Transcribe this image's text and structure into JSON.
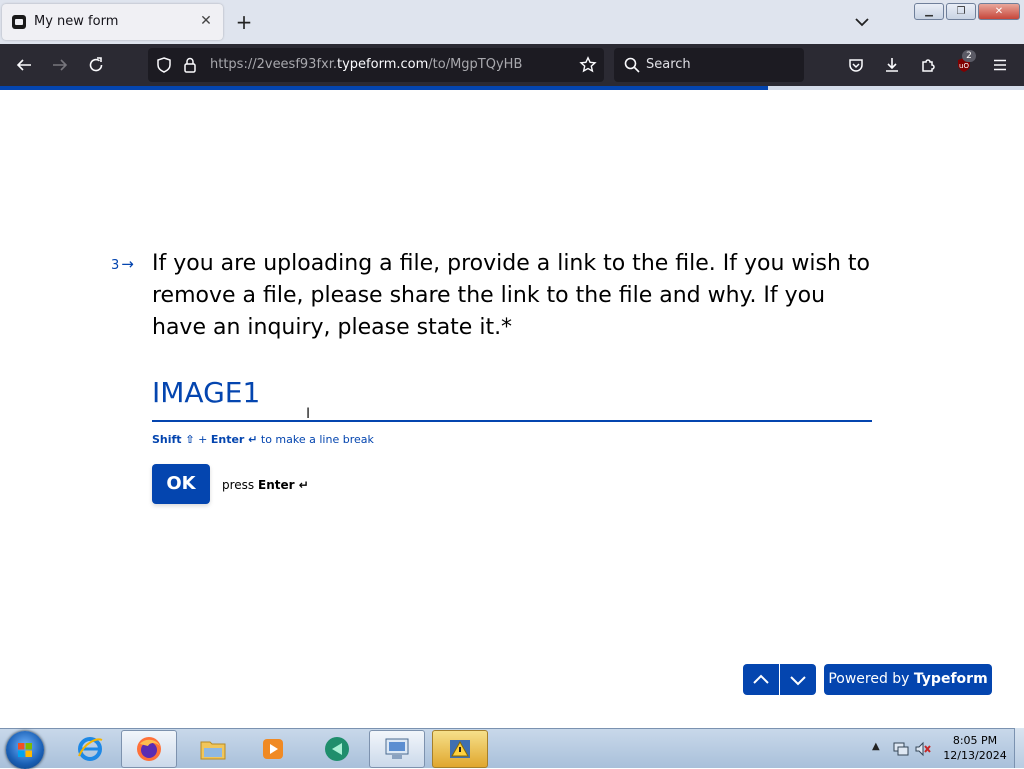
{
  "browser": {
    "tab_title": "My new form",
    "url_prefix": "https://2veesf93fxr.",
    "url_domain": "typeform.com",
    "url_path": "/to/MgpTQyHB",
    "search_placeholder": "Search",
    "extension_badge": "2"
  },
  "form": {
    "progress_fraction": 0.75,
    "question_number": "3",
    "question_text": "If you are uploading a file, provide a link to the file. If you wish to remove a file, please share the link to the file and why. If you have an inquiry, please state it.*",
    "answer_value": "IMAGE1",
    "hint": {
      "shift": "Shift ⇧",
      "plus": " + ",
      "enter": "Enter ↵",
      "rest": " to make a line break"
    },
    "ok_label": "OK",
    "press_label": "press ",
    "press_key": "Enter ↵",
    "powered_prefix": "Powered by ",
    "powered_brand": "Typeform"
  },
  "taskbar": {
    "time": "8:05 PM",
    "date": "12/13/2024"
  },
  "colors": {
    "accent": "#0445af",
    "browser_chrome": "#2b2a33",
    "tabstrip": "#dfe4ee"
  }
}
